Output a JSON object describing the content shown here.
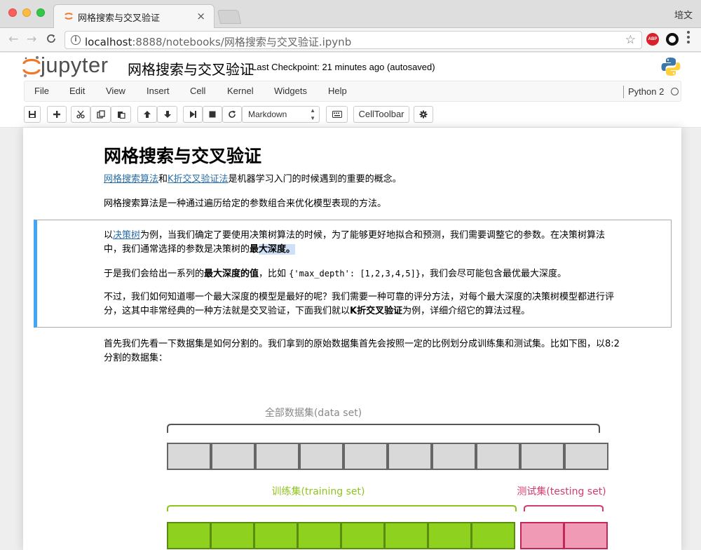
{
  "browser": {
    "tab_title": "网格搜索与交叉验证",
    "tab_close": "×",
    "profile_name": "培文",
    "url_host": "localhost",
    "url_rest": ":8888/notebooks/网格搜索与交叉验证.ipynb",
    "abp_label": "ABP",
    "colors": {
      "abp": "#d9212c",
      "favicon": "#f37726"
    }
  },
  "jupyter": {
    "logo_text": "jupyter",
    "notebook_name": "网格搜索与交叉验证",
    "checkpoint": "Last Checkpoint: 21 minutes ago (autosaved)",
    "menu": [
      "File",
      "Edit",
      "View",
      "Insert",
      "Cell",
      "Kernel",
      "Widgets",
      "Help"
    ],
    "kernel_name": "Python 2",
    "toolbar": {
      "icons": [
        "save-icon",
        "plus-icon",
        "cut-icon",
        "copy-icon",
        "paste-icon",
        "arrow-up-icon",
        "arrow-down-icon",
        "step-forward-icon",
        "stop-icon",
        "restart-icon"
      ],
      "cell_type": "Markdown",
      "keyboard_icon": "keyboard-icon",
      "celltoolbar_label": "CellToolbar",
      "settings_icon": "gear-icon"
    }
  },
  "content": {
    "title": "网格搜索与交叉验证",
    "intro": {
      "link1": "网格搜索算法",
      "and": "和",
      "link2": "K折交叉验证法",
      "rest": "是机器学习入门的时候遇到的重要的概念。"
    },
    "para2": "网格搜索算法是一种通过遍历给定的参数组合来优化模型表现的方法。",
    "cell": {
      "p1_a": "以",
      "p1_link": "决策树",
      "p1_b": "为例，当我们确定了要使用决策树算法的时候，为了能够更好地拟合和预测，我们需要调整它的参数。在决策树算法",
      "p1_c": "中，我们通常选择的参数是决策树的",
      "p1_bold_a": "最",
      "p1_bold_b": "大深度。",
      "p2_a": "于是我们会给出一系列的",
      "p2_bold": "最大深度的值",
      "p2_b": "，比如 ",
      "p2_code": "{'max_depth': [1,2,3,4,5]}",
      "p2_c": "，我们会尽可能包含最优最大深度。",
      "p3_line1": "不过，我们如何知道哪一个最大深度的模型是最好的呢？我们需要一种可靠的评分方法，对每个最大深度的决策树模型都进行评",
      "p3_a": "分，这其中非常经典的一种方法就是交叉验证，下面我们就以",
      "p3_bold": "K折交叉验证",
      "p3_b": "为例，详细介绍它的算法过程。"
    },
    "para4_line1": "首先我们先看一下数据集是如何分割的。我们拿到的原始数据集首先会按照一定的比例划分成训练集和测试集。比如下图，以8:2",
    "para4_line2": "分割的数据集："
  },
  "diagram": {
    "all_label": "全部数据集(data set)",
    "train_label": "训练集(training set)",
    "test_label": "测试集(testing set)",
    "total_blocks": 10,
    "train_blocks": 8,
    "test_blocks": 2,
    "colors": {
      "all": "#d9d9d9",
      "train": "#8fd11f",
      "test": "#f09ab5",
      "train_text": "#8fc31f",
      "test_text": "#d23c6e",
      "all_text": "#888888"
    }
  }
}
